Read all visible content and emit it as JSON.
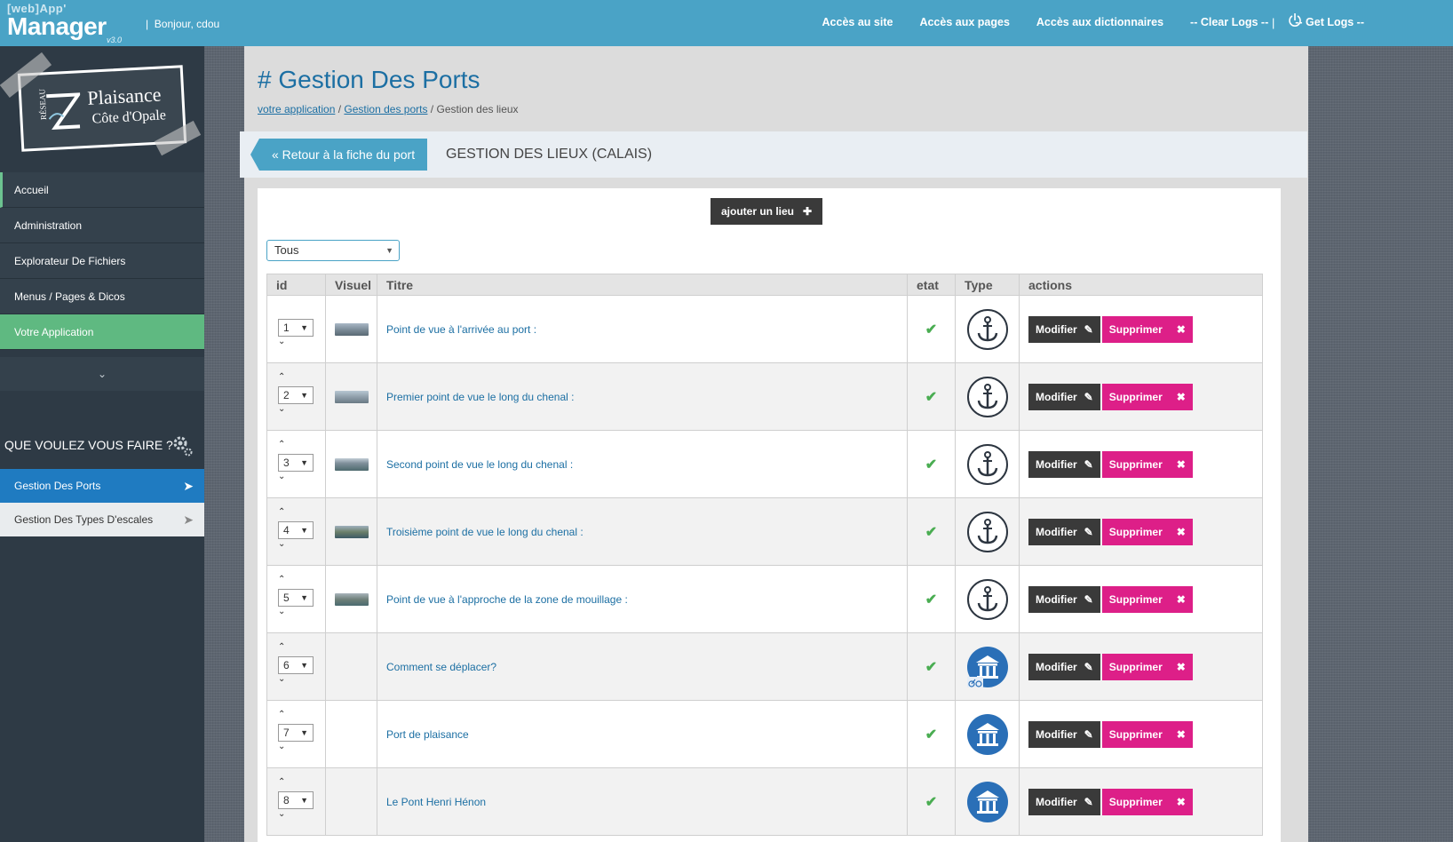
{
  "header": {
    "logo_small": "[web]App'",
    "logo_big": "Manager",
    "logo_version": "v3.0",
    "greeting": "Bonjour, cdou",
    "nav": [
      "Accès au site",
      "Accès aux pages",
      "Accès aux dictionnaires",
      "-- Clear Logs --",
      "-- Get Logs --"
    ],
    "separator": "|"
  },
  "brand": {
    "reseau": "RÉSEAU",
    "line1": "Plaisance",
    "line2": "Côte d'Opale"
  },
  "sidebar": {
    "items": [
      "Accueil",
      "Administration",
      "Explorateur De Fichiers",
      "Menus / Pages & Dicos",
      "Votre Application"
    ],
    "section_title": "QUE VOULEZ VOUS FAIRE ?",
    "sub_items": [
      "Gestion Des Ports",
      "Gestion Des Types D'escales"
    ]
  },
  "page": {
    "title": "# Gestion Des Ports",
    "breadcrumb": [
      "votre application",
      "Gestion des ports",
      "Gestion des lieux"
    ],
    "back_button": "« Retour à la fiche du port",
    "subtitle": "GESTION DES LIEUX (CALAIS)",
    "add_button": "ajouter un lieu",
    "filter_value": "Tous"
  },
  "table": {
    "headers": [
      "id",
      "Visuel",
      "Titre",
      "etat",
      "Type",
      "actions"
    ],
    "rows": [
      {
        "id": "1",
        "title": "Point de vue à l'arrivée au port :",
        "icon": "anchor-icon"
      },
      {
        "id": "2",
        "title": "Premier point de vue le long du chenal :",
        "icon": "anchor-icon"
      },
      {
        "id": "3",
        "title": "Second point de vue le long du chenal :",
        "icon": "anchor-icon"
      },
      {
        "id": "4",
        "title": "Troisième point de vue le long du chenal :",
        "icon": "anchor-icon"
      },
      {
        "id": "5",
        "title": "Point de vue à l'approche de la zone de mouillage :",
        "icon": "anchor-icon"
      },
      {
        "id": "6",
        "title": "Comment se déplacer?",
        "icon": "building-bike-icon"
      },
      {
        "id": "7",
        "title": "Port de plaisance",
        "icon": "building-icon"
      },
      {
        "id": "8",
        "title": "Le Pont Henri Hénon",
        "icon": "building-icon"
      }
    ],
    "modify_label": "Modifier",
    "delete_label": "Supprimer"
  },
  "colors": {
    "topbar": "#4aa3c6",
    "sidebar": "#2e3a45",
    "active_green": "#5fb981",
    "active_blue": "#1f7bc1",
    "delete": "#dd1f88",
    "link": "#1c6fa3"
  }
}
